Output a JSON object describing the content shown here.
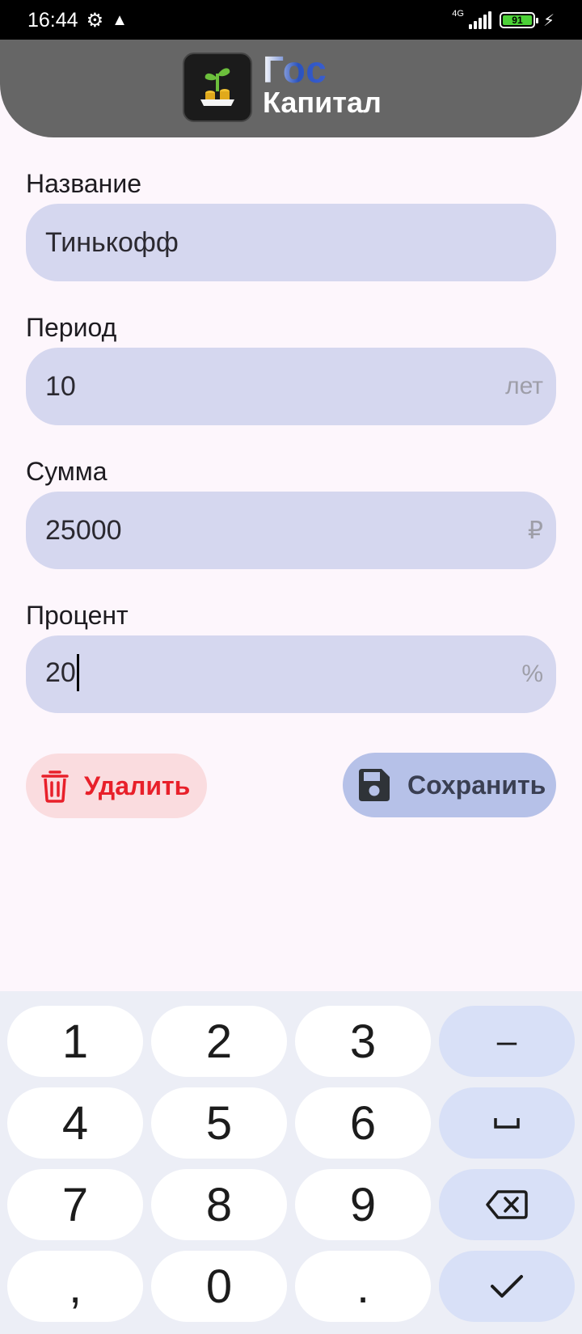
{
  "status_bar": {
    "time": "16:44",
    "network": "4G",
    "battery": "91"
  },
  "header": {
    "logo_line1": "Гос",
    "logo_line2": "Капитал"
  },
  "form": {
    "name": {
      "label": "Название",
      "value": "Тинькофф"
    },
    "period": {
      "label": "Период",
      "value": "10",
      "suffix": "лет"
    },
    "sum": {
      "label": "Сумма",
      "value": "25000",
      "suffix": "₽"
    },
    "percent": {
      "label": "Процент",
      "value": "20",
      "suffix": "%"
    }
  },
  "actions": {
    "delete_label": "Удалить",
    "save_label": "Сохранить"
  },
  "keyboard": {
    "k1": "1",
    "k2": "2",
    "k3": "3",
    "minus": "–",
    "k4": "4",
    "k5": "5",
    "k6": "6",
    "space": "␣",
    "k7": "7",
    "k8": "8",
    "k9": "9",
    "comma": ",",
    "k0": "0",
    "dot": "."
  },
  "icons": {
    "settings": "gear-icon",
    "warning": "warning-icon",
    "signal": "signal-icon",
    "battery": "battery-icon",
    "charging": "bolt-icon",
    "delete": "trash-icon",
    "save": "floppy-disk-icon",
    "backspace": "backspace-icon",
    "done": "checkmark-icon"
  },
  "colors": {
    "field_bg": "#d5d7ef",
    "delete_bg": "#fadcdf",
    "delete_text": "#e8202a",
    "save_bg": "#b6c1e8",
    "header_bg": "#666666"
  }
}
